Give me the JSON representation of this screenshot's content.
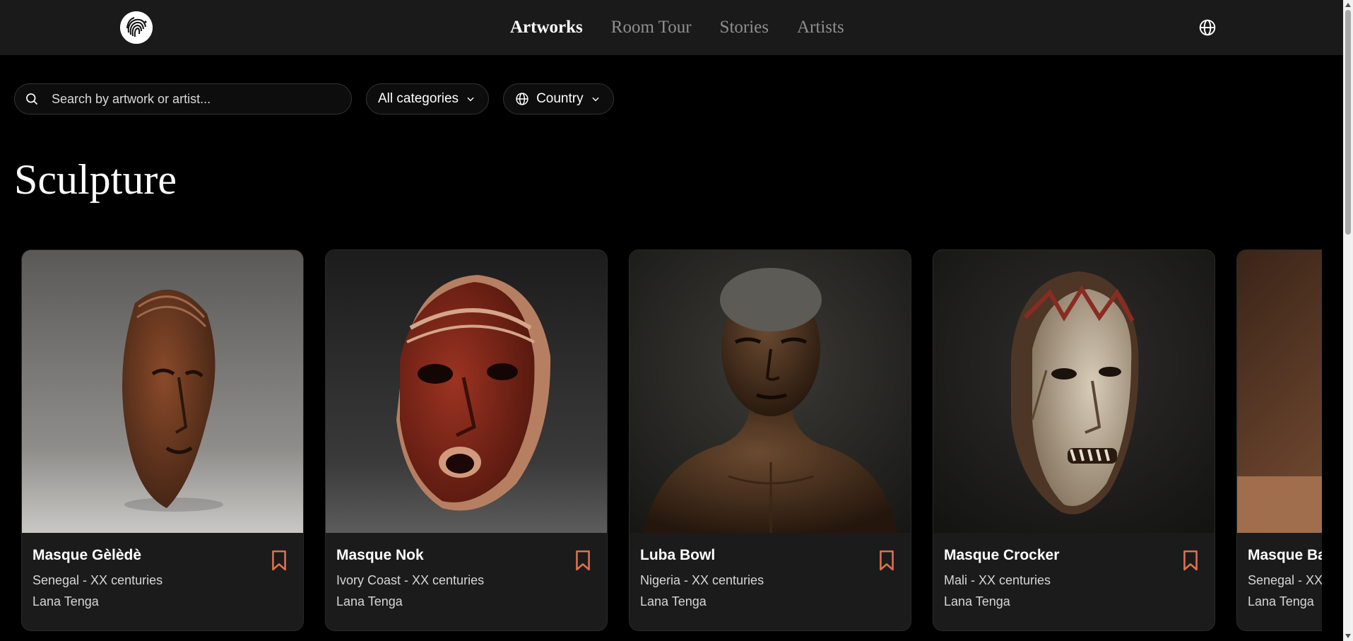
{
  "nav": {
    "items": [
      {
        "label": "Artworks",
        "active": true
      },
      {
        "label": "Room Tour",
        "active": false
      },
      {
        "label": "Stories",
        "active": false
      },
      {
        "label": "Artists",
        "active": false
      }
    ],
    "language_icon": "globe-icon"
  },
  "filters": {
    "search_placeholder": "Search by artwork or artist...",
    "category_label": "All categories",
    "country_label": "Country"
  },
  "section": {
    "title": "Sculpture"
  },
  "cards": [
    {
      "title": "Masque Gèlèdè",
      "meta": "Senegal - XX centuries",
      "artist": "Lana Tenga"
    },
    {
      "title": "Masque Nok",
      "meta": "Ivory Coast - XX centuries",
      "artist": "Lana Tenga"
    },
    {
      "title": "Luba Bowl",
      "meta": "Nigeria - XX centuries",
      "artist": "Lana Tenga"
    },
    {
      "title": "Masque Crocker",
      "meta": "Mali - XX centuries",
      "artist": "Lana Tenga"
    },
    {
      "title": "Masque Ba",
      "meta": "Senegal - XX",
      "artist": "Lana Tenga"
    }
  ],
  "colors": {
    "accent": "#e0704c",
    "nav_bg": "#1a1a1a",
    "card_bg": "#1b1b1b",
    "page_bg": "#000000"
  }
}
